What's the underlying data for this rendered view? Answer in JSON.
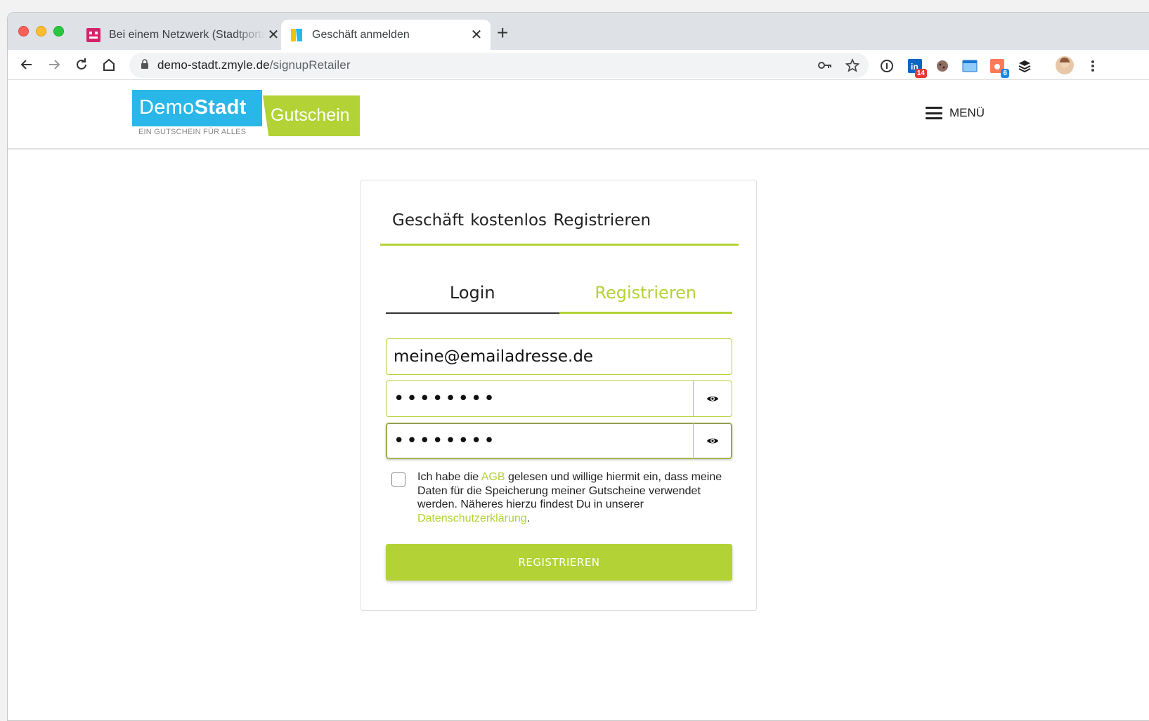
{
  "browser": {
    "tabs": [
      {
        "title": "Bei einem Netzwerk (Stadtportal",
        "favicon": "pink-robot-icon",
        "active": false
      },
      {
        "title": "Geschäft anmelden",
        "favicon": "demostadt-flag-icon",
        "active": true
      }
    ],
    "url_host": "demo-stadt.zmyle.de",
    "url_path": "/signupRetailer",
    "extension_badges": {
      "linkedin": "14",
      "hubspot": "6"
    }
  },
  "site": {
    "logo": {
      "demo": "Demo",
      "stadt": "Stadt",
      "gutschein": "Gutschein",
      "tagline": "EIN GUTSCHEIN FÜR ALLES"
    },
    "menu_label": "MENÜ"
  },
  "card": {
    "title": "Geschäft kostenlos Registrieren",
    "tabs": [
      {
        "label": "Login",
        "active": false
      },
      {
        "label": "Registrieren",
        "active": true
      }
    ],
    "email_value": "meine@emailadresse.de",
    "password_value": "••••••••",
    "password_confirm_value": "••••••••",
    "consent": {
      "part1": "Ich habe die ",
      "agb_link": "AGB",
      "part2": " gelesen und willige hiermit ein, dass meine Daten für die Speicherung meiner Gutscheine verwendet werden. Näheres hierzu findest Du in unserer ",
      "privacy_link": "Datenschutzerklärung",
      "part3": "."
    },
    "submit_label": "REGISTRIEREN"
  },
  "colors": {
    "accent": "#b2d235",
    "brand_blue": "#29b6e8"
  }
}
